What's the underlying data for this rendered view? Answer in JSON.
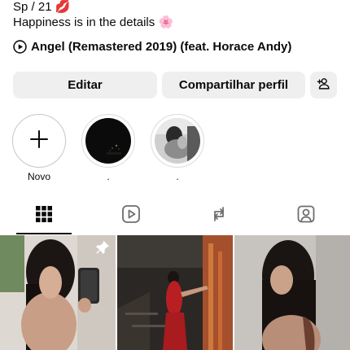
{
  "bio": {
    "line1": "Sp / 21",
    "line1_emoji": "💋",
    "line2": "Happiness is in the details",
    "line2_emoji": "🌸"
  },
  "music": {
    "icon": "play-circle-icon",
    "track": "Angel (Remastered 2019) (feat. Horace Andy)"
  },
  "buttons": {
    "edit": "Editar",
    "share": "Compartilhar perfil",
    "add_user_icon": "add-person-icon"
  },
  "highlights": [
    {
      "label": "Novo",
      "icon": "plus-icon"
    },
    {
      "label": "."
    },
    {
      "label": "."
    }
  ],
  "tabs": [
    {
      "icon": "grid-icon",
      "active": true
    },
    {
      "icon": "reels-icon",
      "active": false
    },
    {
      "icon": "reposts-icon",
      "active": false
    },
    {
      "icon": "tagged-icon",
      "active": false
    }
  ],
  "posts": [
    {
      "pinned": true,
      "pin_icon": "pin-icon"
    },
    {
      "pinned": false
    },
    {
      "pinned": false
    }
  ],
  "colors": {
    "button_bg": "#efefef",
    "text": "#0a0a0a",
    "highlight_ring": "#dbdbdb"
  }
}
